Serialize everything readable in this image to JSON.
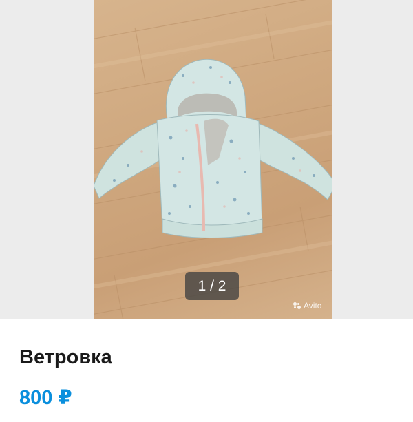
{
  "gallery": {
    "counter": "1 / 2",
    "watermark": "Avito"
  },
  "listing": {
    "title": "Ветровка",
    "price": "800 ₽"
  },
  "colors": {
    "price": "#0a8fdd",
    "gallery_background": "#ececec",
    "floor": "#cfa87f",
    "jacket": "#d3e6e4"
  },
  "icons": {
    "watermark": "avito-logo-icon"
  }
}
